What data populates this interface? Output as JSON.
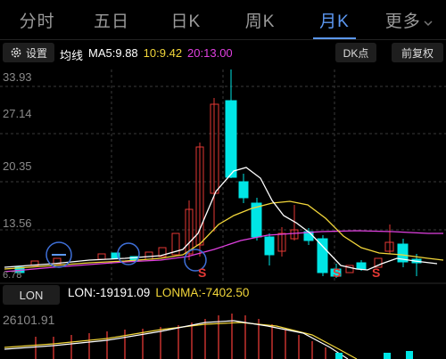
{
  "tabs": [
    {
      "label": "分时"
    },
    {
      "label": "五日"
    },
    {
      "label": "日K"
    },
    {
      "label": "周K"
    },
    {
      "label": "月K"
    },
    {
      "label": "更多"
    }
  ],
  "active_tab": "月K",
  "more_icon": "chevron-down-icon",
  "toolbar": {
    "settings_label": "设置",
    "dk_label": "DK点",
    "adjust_label": "前复权"
  },
  "indicator": {
    "title": "均线",
    "ma5": "MA5:9.88",
    "ma10": "10:9.42",
    "ma20": "20:13.00",
    "ma5_color": "#ffffff",
    "ma10_color": "#f2d63a",
    "ma20_color": "#e040e0"
  },
  "price_axis": [
    "33.93",
    "27.14",
    "20.35",
    "13.56",
    "6.78"
  ],
  "markers": [
    "S",
    "S",
    "S"
  ],
  "lon_panel": {
    "button": "LON",
    "lon": "LON:-19191.09",
    "lonma": "LONMA:-7402.50",
    "axis_top": "26101.91"
  },
  "colors": {
    "up": "#e53935",
    "down": "#00e5e5",
    "accent": "#5c98f2"
  }
}
